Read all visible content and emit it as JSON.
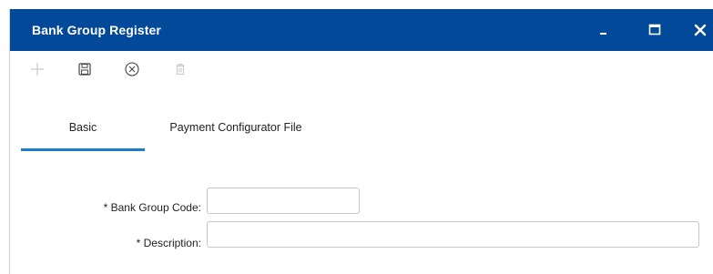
{
  "window": {
    "title": "Bank Group Register",
    "accent_color": "#02499a",
    "controls": [
      {
        "name": "minimize",
        "icon": "minimize-icon",
        "glyph": "_"
      },
      {
        "name": "maximize",
        "icon": "maximize-icon"
      },
      {
        "name": "close",
        "icon": "close-icon",
        "glyph": "✕"
      }
    ]
  },
  "toolbar": {
    "buttons": [
      {
        "name": "add",
        "icon": "plus-icon",
        "enabled": false
      },
      {
        "name": "save",
        "icon": "floppy-disk-icon",
        "enabled": true
      },
      {
        "name": "cancel",
        "icon": "circle-x-icon",
        "enabled": true
      },
      {
        "name": "delete",
        "icon": "trash-icon",
        "enabled": false
      }
    ]
  },
  "tabs": [
    {
      "label": "Basic",
      "active": true
    },
    {
      "label": "Payment Configurator File",
      "active": false
    }
  ],
  "form": {
    "bank_group_code": {
      "label": "* Bank Group Code:",
      "value": ""
    },
    "description": {
      "label": "* Description:",
      "value": ""
    }
  }
}
